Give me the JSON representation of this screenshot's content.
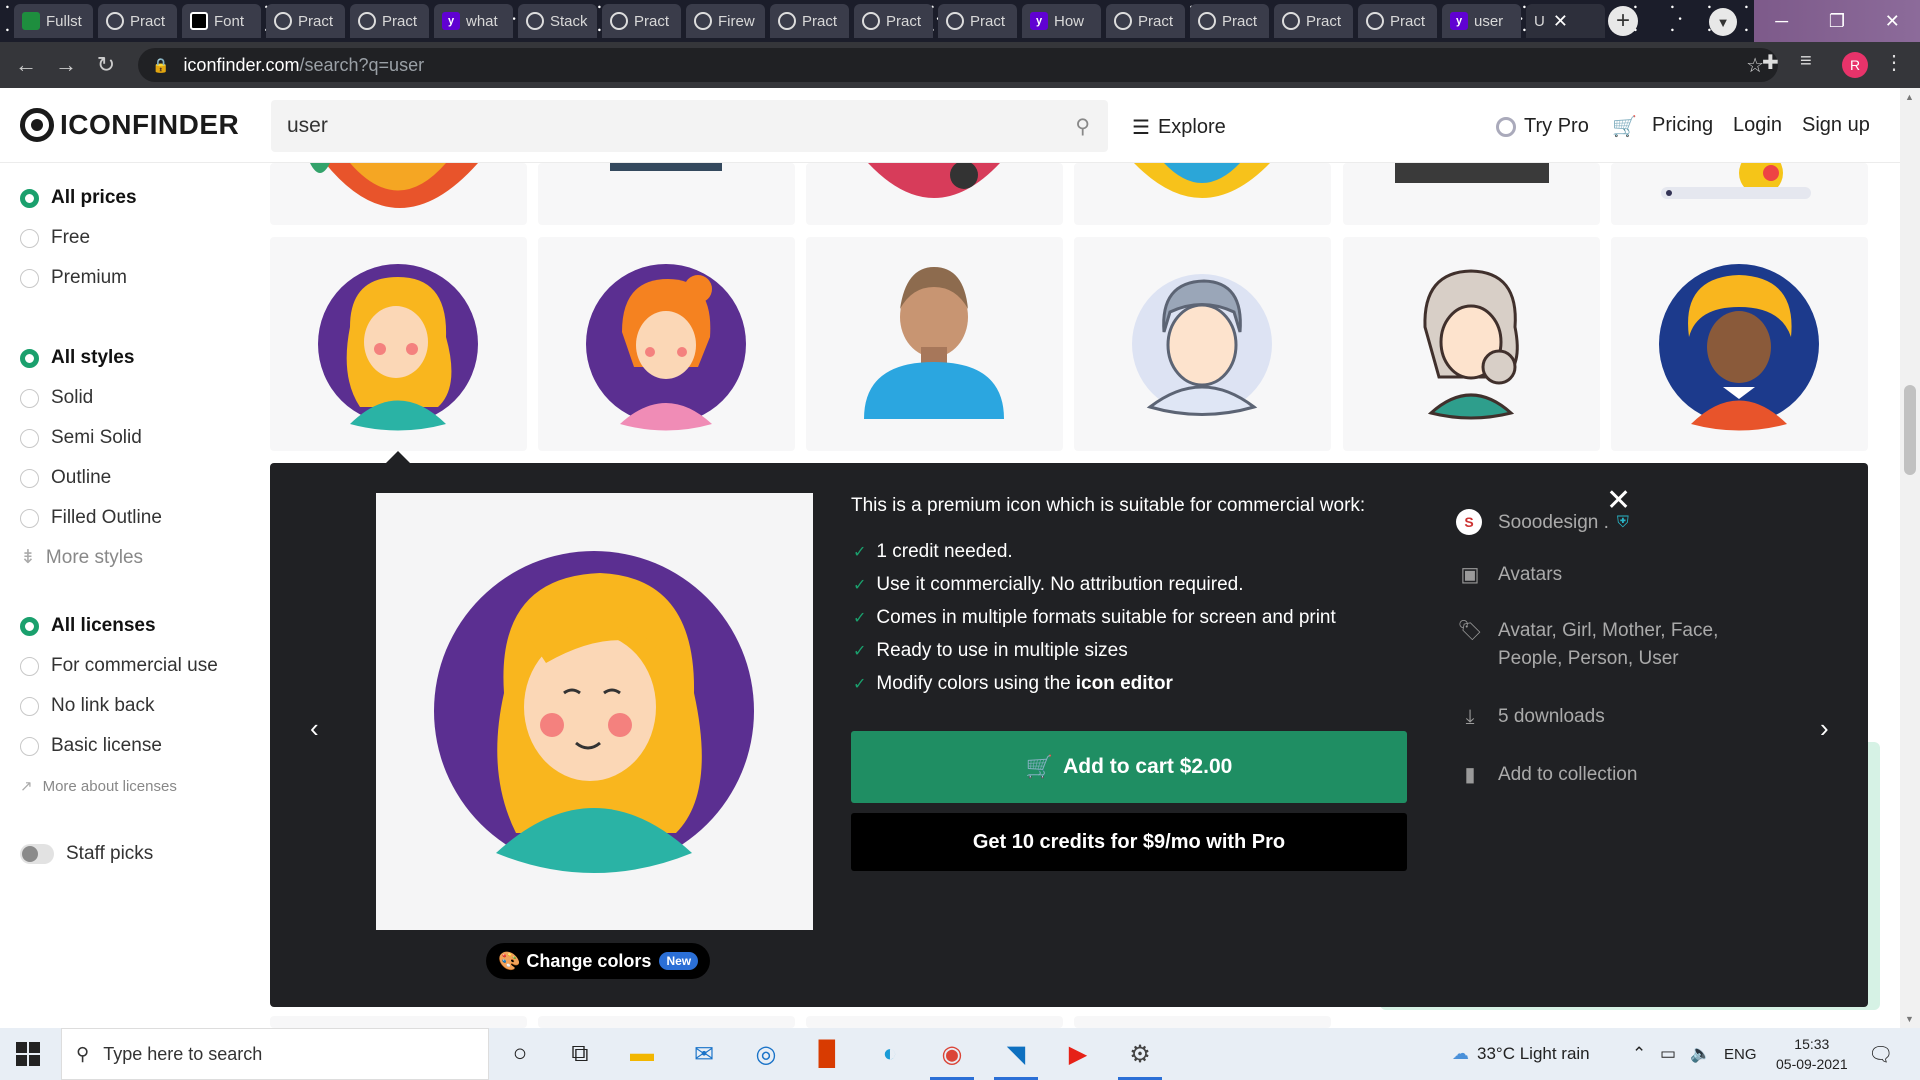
{
  "browser": {
    "tabs": [
      {
        "title": "Fullst",
        "icon": "green"
      },
      {
        "title": "Pract",
        "icon": "circle"
      },
      {
        "title": "Font",
        "icon": "sq"
      },
      {
        "title": "Pract",
        "icon": "circle"
      },
      {
        "title": "Pract",
        "icon": "circle"
      },
      {
        "title": "what",
        "icon": "yahoo"
      },
      {
        "title": "Stack",
        "icon": "circle"
      },
      {
        "title": "Pract",
        "icon": "circle"
      },
      {
        "title": "Firew",
        "icon": "circle"
      },
      {
        "title": "Pract",
        "icon": "circle"
      },
      {
        "title": "Pract",
        "icon": "circle"
      },
      {
        "title": "Pract",
        "icon": "circle"
      },
      {
        "title": "How",
        "icon": "yahoo"
      },
      {
        "title": "Pract",
        "icon": "circle"
      },
      {
        "title": "Pract",
        "icon": "circle"
      },
      {
        "title": "Pract",
        "icon": "circle"
      },
      {
        "title": "Pract",
        "icon": "circle"
      },
      {
        "title": "user",
        "icon": "yahoo"
      },
      {
        "title": "U",
        "icon": "none"
      }
    ],
    "new_tab": "+",
    "url_host": "iconfinder.com",
    "url_path": "/search?q=user",
    "profile_initial": "R"
  },
  "header": {
    "logo": "ICONFINDER",
    "search_value": "user",
    "explore": "Explore",
    "try_pro": "Try Pro",
    "pricing": "Pricing",
    "login": "Login",
    "signup": "Sign up"
  },
  "sidebar": {
    "prices": [
      "All prices",
      "Free",
      "Premium"
    ],
    "styles": [
      "All styles",
      "Solid",
      "Semi Solid",
      "Outline",
      "Filled Outline"
    ],
    "more_styles": "More styles",
    "licenses": [
      "All licenses",
      "For commercial use",
      "No link back",
      "Basic license"
    ],
    "more_licenses": "More about licenses",
    "staff_picks": "Staff picks"
  },
  "detail": {
    "change_colors": "Change colors",
    "new_badge": "New",
    "premium_title": "This is a premium icon which is suitable for commercial work:",
    "features": [
      "1 credit needed.",
      "Use it commercially. No attribution required.",
      "Comes in multiple formats suitable for screen and print",
      "Ready to use in multiple sizes",
      "Modify colors using the"
    ],
    "icon_editor": "icon editor",
    "add_to_cart": "Add to cart $2.00",
    "get_pro": "Get 10 credits for $9/mo with Pro",
    "author": "Sooodesign .",
    "set": "Avatars",
    "tags_line1": "Avatar, Girl, Mother, Face,",
    "tags_line2": "People, Person, User",
    "downloads": "5 downloads",
    "add_collection": "Add to collection"
  },
  "colors": {
    "accent_green": "#1f8e63",
    "panel_bg": "#202124",
    "avatar_purple": "#5b2f91",
    "hair_yellow": "#f9b61e"
  },
  "taskbar": {
    "search_placeholder": "Type here to search",
    "weather": "33°C  Light rain",
    "lang": "ENG",
    "time": "15:33",
    "date": "05-09-2021"
  }
}
